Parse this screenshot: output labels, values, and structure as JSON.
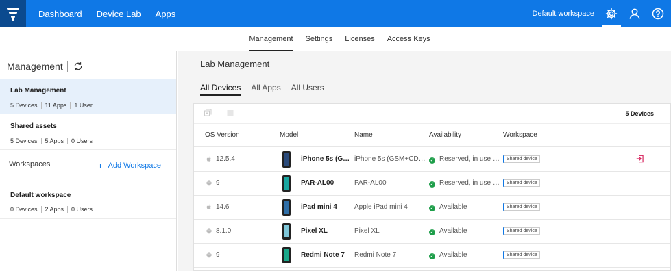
{
  "topbar": {
    "nav": [
      "Dashboard",
      "Device Lab",
      "Apps"
    ],
    "workspace_label": "Default workspace",
    "icons": [
      "settings-gear-icon",
      "user-icon",
      "help-icon"
    ],
    "brand_color": "#0f78e6"
  },
  "subnav": {
    "tabs": [
      "Management",
      "Settings",
      "Licenses",
      "Access Keys"
    ],
    "active": "Management"
  },
  "sidebar": {
    "title": "Management",
    "sections": [
      {
        "title": "Lab Management",
        "stats": [
          "5 Devices",
          "11 Apps",
          "1 User"
        ],
        "active": true
      },
      {
        "title": "Shared assets",
        "stats": [
          "5 Devices",
          "5 Apps",
          "0 Users"
        ],
        "active": false
      }
    ],
    "workspaces_label": "Workspaces",
    "add_workspace_label": "Add Workspace",
    "workspaces": [
      {
        "title": "Default workspace",
        "stats": [
          "0 Devices",
          "2 Apps",
          "0 Users"
        ]
      }
    ]
  },
  "main": {
    "title": "Lab Management",
    "tabs": [
      "All Devices",
      "All Apps",
      "All Users"
    ],
    "active_tab": "All Devices",
    "device_count": "5 Devices",
    "columns": [
      "OS Version",
      "Model",
      "Name",
      "Availability",
      "Workspace"
    ],
    "rows": [
      {
        "os": "ios",
        "os_version": "12.5.4",
        "model": "iPhone 5s (G…",
        "name": "iPhone 5s (GSM+CD…",
        "availability": "Reserved, in use …",
        "workspace": "Shared device",
        "screen_color": "#2a4a7a",
        "action_icon": "login-icon"
      },
      {
        "os": "android",
        "os_version": "9",
        "model": "PAR-AL00",
        "name": "PAR-AL00",
        "availability": "Reserved, in use …",
        "workspace": "Shared device",
        "screen_color": "#19a6a0",
        "action_icon": ""
      },
      {
        "os": "ios",
        "os_version": "14.6",
        "model": "iPad mini 4",
        "name": "Apple iPad mini 4",
        "availability": "Available",
        "workspace": "Shared device",
        "screen_color": "#2f6fa8",
        "action_icon": ""
      },
      {
        "os": "android",
        "os_version": "8.1.0",
        "model": "Pixel XL",
        "name": "Pixel XL",
        "availability": "Available",
        "workspace": "Shared device",
        "screen_color": "#7fc7d9",
        "action_icon": ""
      },
      {
        "os": "android",
        "os_version": "9",
        "model": "Redmi Note 7",
        "name": "Redmi Note 7",
        "availability": "Available",
        "workspace": "Shared device",
        "screen_color": "#1aa88a",
        "action_icon": ""
      }
    ]
  }
}
